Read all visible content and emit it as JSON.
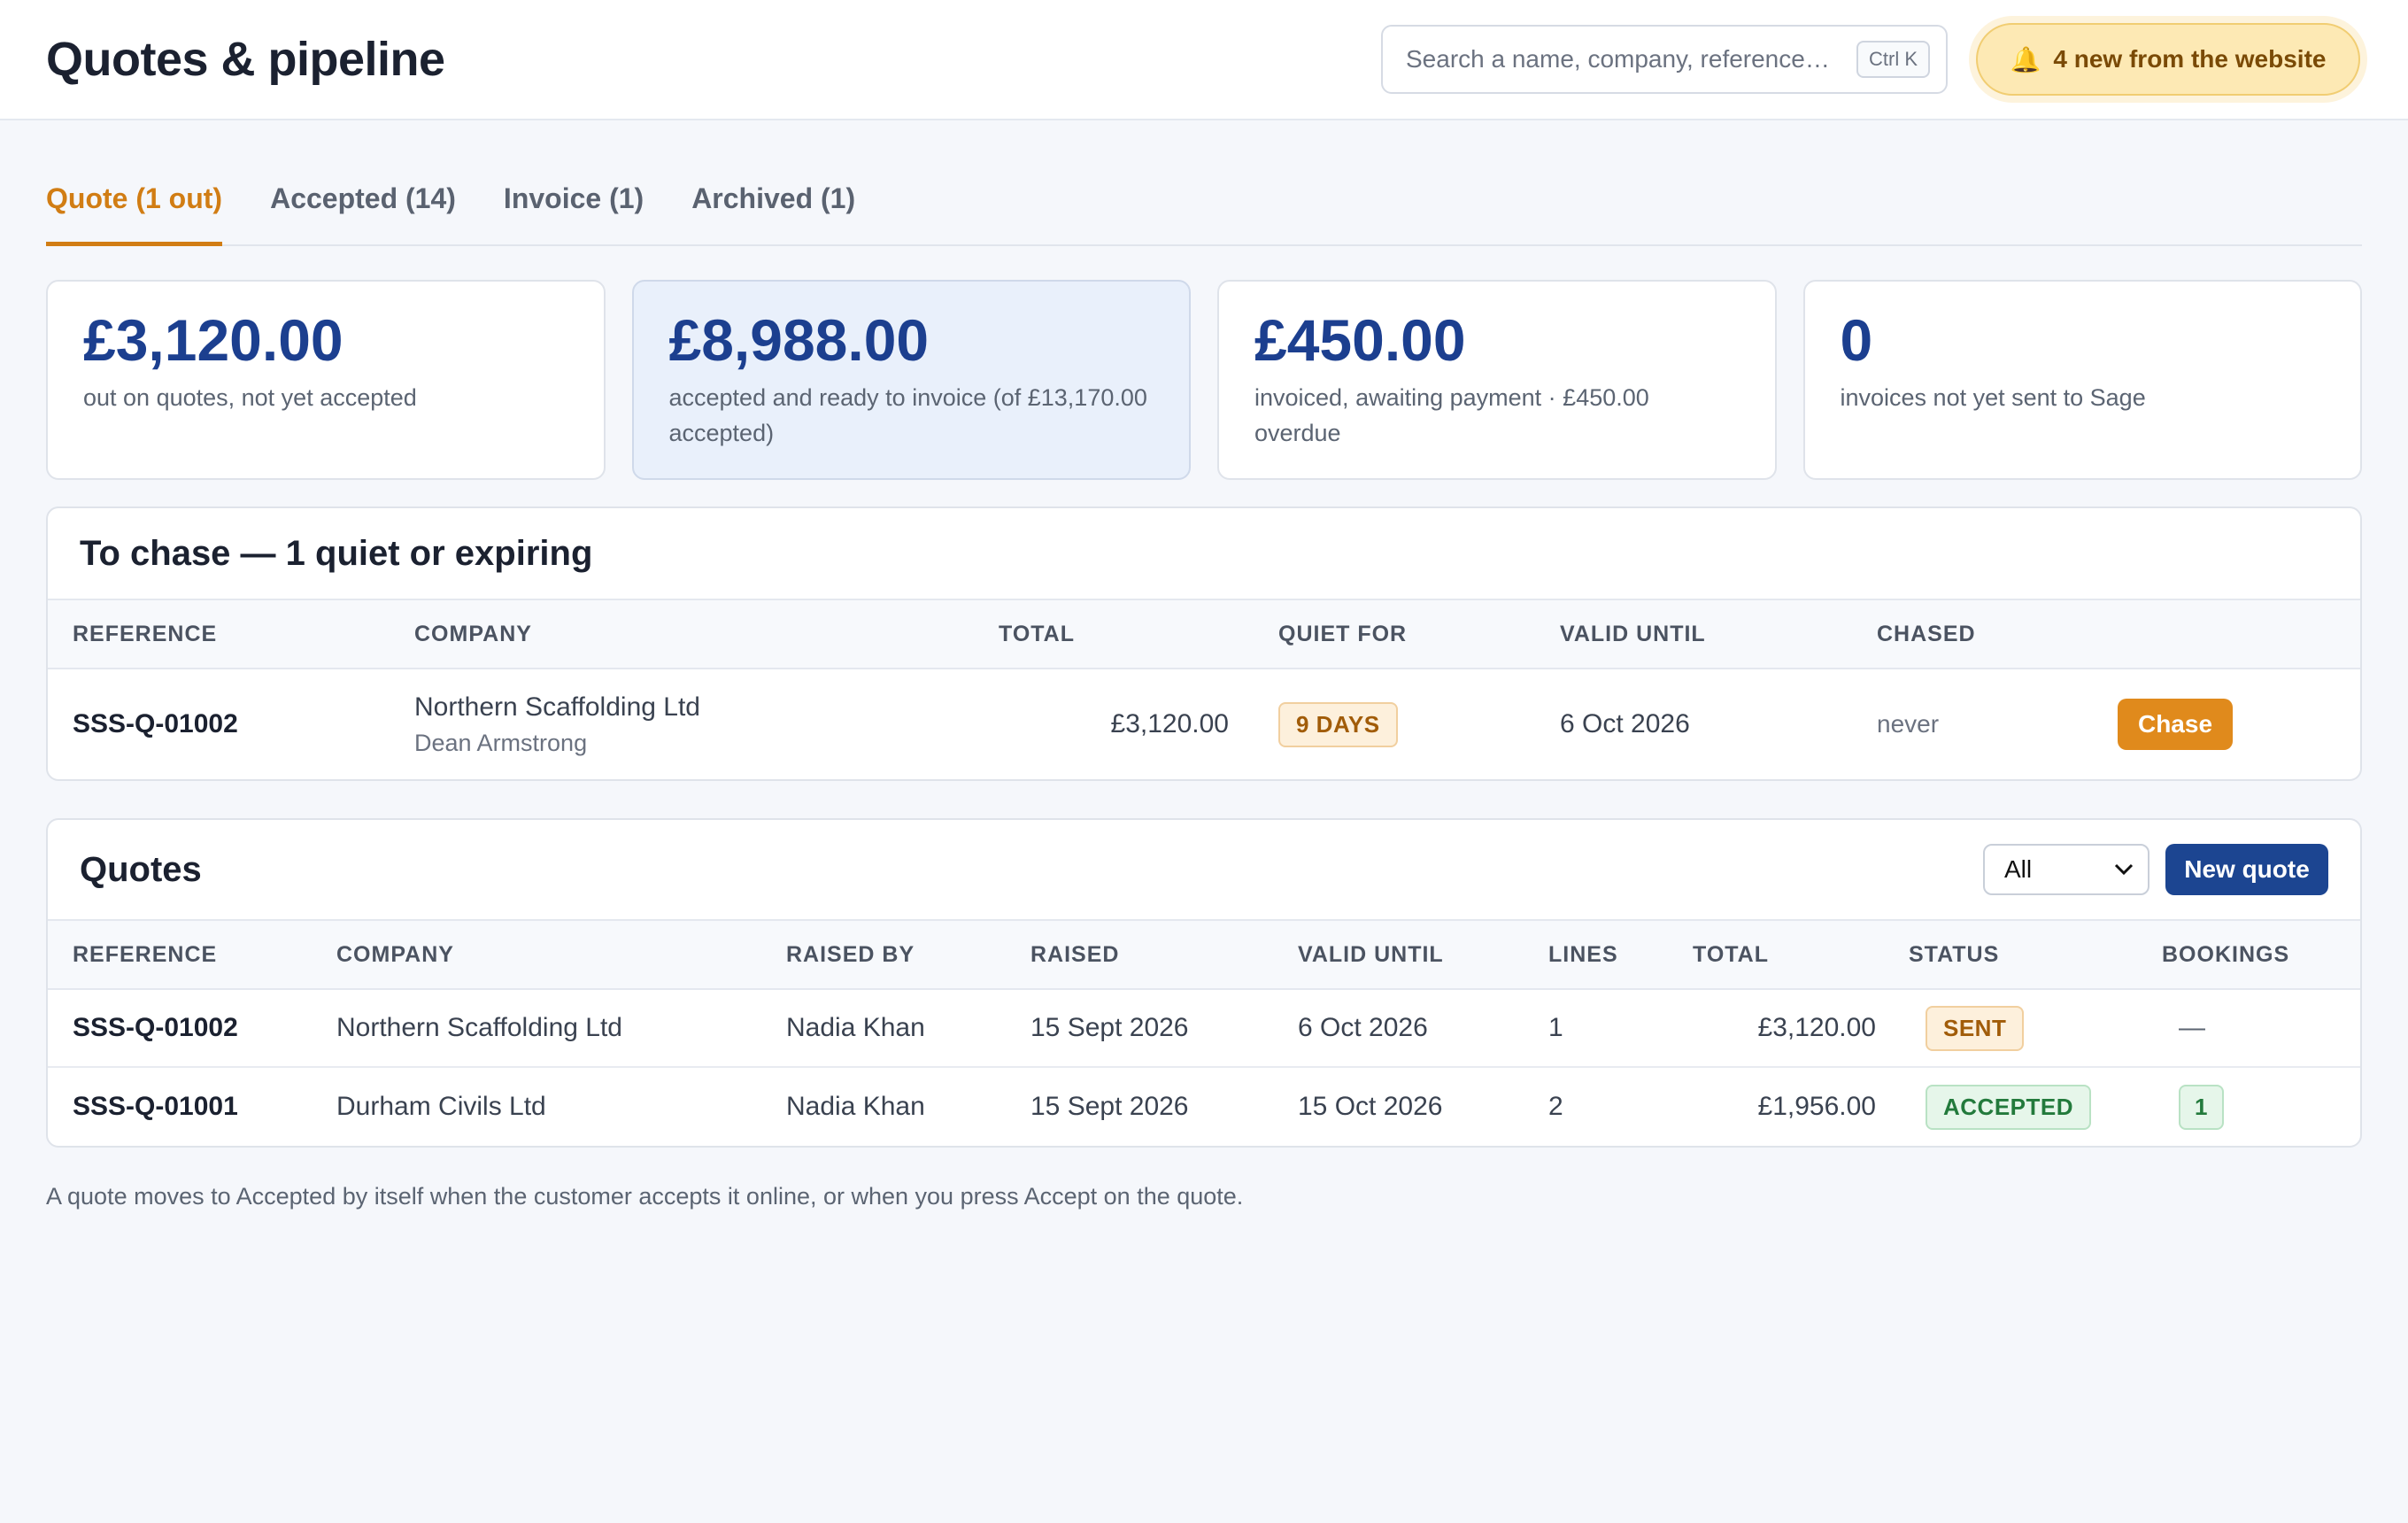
{
  "header": {
    "title": "Quotes & pipeline",
    "search_placeholder": "Search a name, company, reference…",
    "search_shortcut": "Ctrl K",
    "notification": "4 new from the website"
  },
  "tabs": [
    {
      "label": "Quote (1 out)",
      "active": true
    },
    {
      "label": "Accepted (14)",
      "active": false
    },
    {
      "label": "Invoice (1)",
      "active": false
    },
    {
      "label": "Archived (1)",
      "active": false
    }
  ],
  "stats": [
    {
      "value": "£3,120.00",
      "label": "out on quotes, not yet accepted"
    },
    {
      "value": "£8,988.00",
      "label": "accepted and ready to invoice (of £13,170.00 accepted)"
    },
    {
      "value": "£450.00",
      "label": "invoiced, awaiting payment · £450.00 overdue"
    },
    {
      "value": "0",
      "label": "invoices not yet sent to Sage"
    }
  ],
  "chase": {
    "title": "To chase — 1 quiet or expiring",
    "columns": [
      "REFERENCE",
      "COMPANY",
      "TOTAL",
      "QUIET FOR",
      "VALID UNTIL",
      "CHASED"
    ],
    "rows": [
      {
        "reference": "SSS-Q-01002",
        "company": "Northern Scaffolding Ltd",
        "contact": "Dean Armstrong",
        "total": "£3,120.00",
        "quiet_for": "9 DAYS",
        "valid_until": "6 Oct 2026",
        "chased": "never",
        "action": "Chase"
      }
    ]
  },
  "quotes": {
    "title": "Quotes",
    "filter_value": "All",
    "new_button": "New quote",
    "columns": [
      "REFERENCE",
      "COMPANY",
      "RAISED BY",
      "RAISED",
      "VALID UNTIL",
      "LINES",
      "TOTAL",
      "STATUS",
      "BOOKINGS"
    ],
    "rows": [
      {
        "reference": "SSS-Q-01002",
        "company": "Northern Scaffolding Ltd",
        "raised_by": "Nadia Khan",
        "raised": "15 Sept 2026",
        "valid_until": "6 Oct 2026",
        "lines": "1",
        "total": "£3,120.00",
        "status": "SENT",
        "bookings": "—"
      },
      {
        "reference": "SSS-Q-01001",
        "company": "Durham Civils Ltd",
        "raised_by": "Nadia Khan",
        "raised": "15 Sept 2026",
        "valid_until": "15 Oct 2026",
        "lines": "2",
        "total": "£1,956.00",
        "status": "ACCEPTED",
        "bookings": "1"
      }
    ]
  },
  "footnote": "A quote moves to Accepted by itself when the customer accepts it online, or when you press Accept on the quote.",
  "colors": {
    "accent": "#d17d14",
    "primary": "#1c4591",
    "stat_value": "#1c3f8f"
  },
  "icons": {
    "notification": "bell-icon",
    "select": "chevron-down-icon"
  }
}
